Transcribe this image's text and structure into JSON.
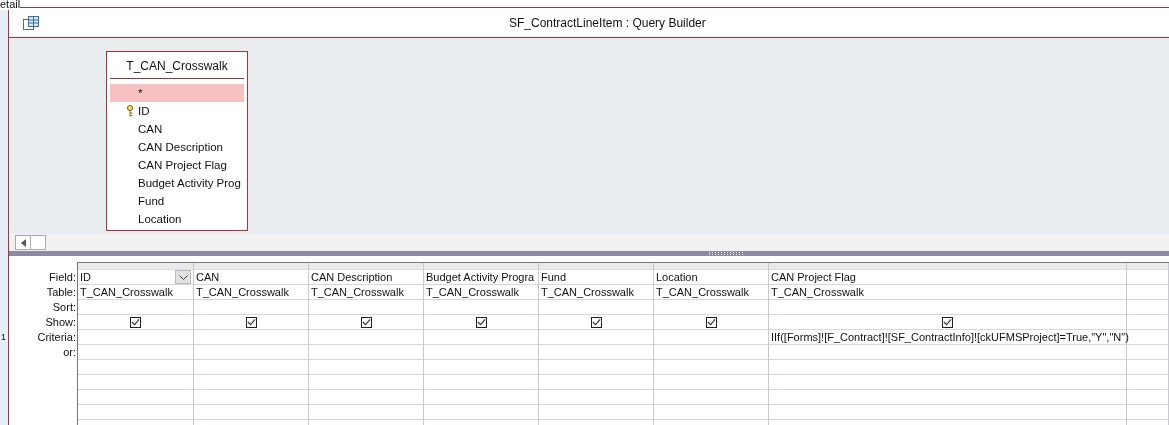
{
  "background": {
    "label": "etail",
    "ruler_mark": "1"
  },
  "window": {
    "title": "SF_ContractLineItem : Query Builder"
  },
  "field_list": {
    "title": "T_CAN_Crosswalk",
    "fields": [
      {
        "name": "*",
        "selected": true,
        "key": false
      },
      {
        "name": "ID",
        "selected": false,
        "key": true
      },
      {
        "name": "CAN",
        "selected": false,
        "key": false
      },
      {
        "name": "CAN Description",
        "selected": false,
        "key": false
      },
      {
        "name": "CAN Project Flag",
        "selected": false,
        "key": false
      },
      {
        "name": "Budget Activity Prog",
        "selected": false,
        "key": false
      },
      {
        "name": "Fund",
        "selected": false,
        "key": false
      },
      {
        "name": "Location",
        "selected": false,
        "key": false
      }
    ]
  },
  "grid": {
    "row_labels": [
      "Field:",
      "Table:",
      "Sort:",
      "Show:",
      "Criteria:",
      "or:"
    ],
    "columns": [
      {
        "field": "ID",
        "table": "T_CAN_Crosswalk",
        "show": true,
        "dropdown": true
      },
      {
        "field": "CAN",
        "table": "T_CAN_Crosswalk",
        "show": true,
        "dropdown": false
      },
      {
        "field": "CAN Description",
        "table": "T_CAN_Crosswalk",
        "show": true,
        "dropdown": false
      },
      {
        "field": "Budget Activity Progra",
        "table": "T_CAN_Crosswalk",
        "show": true,
        "dropdown": false
      },
      {
        "field": "Fund",
        "table": "T_CAN_Crosswalk",
        "show": true,
        "dropdown": false
      },
      {
        "field": "Location",
        "table": "T_CAN_Crosswalk",
        "show": true,
        "dropdown": false
      },
      {
        "field": "CAN Project Flag",
        "table": "T_CAN_Crosswalk",
        "show": true,
        "dropdown": false,
        "criteria": "IIf([Forms]![F_Contract]![SF_ContractInfo]![ckUFMSProject]=True,\"Y\",\"N\")"
      }
    ]
  }
}
